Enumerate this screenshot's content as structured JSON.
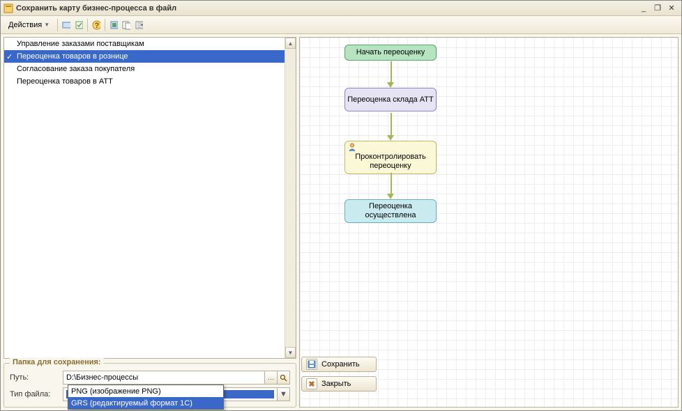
{
  "window": {
    "title": "Сохранить карту бизнес-процесса в файл"
  },
  "toolbar": {
    "actions_label": "Действия"
  },
  "process_list": {
    "items": [
      {
        "label": "Управление заказами поставщикам",
        "selected": false
      },
      {
        "label": "Переоценка товаров в рознице",
        "selected": true
      },
      {
        "label": "Согласование заказа покупателя",
        "selected": false
      },
      {
        "label": "Переоценка товаров в АТТ",
        "selected": false
      }
    ]
  },
  "save_fieldset": {
    "legend": "Папка для сохранения:",
    "path_label": "Путь:",
    "path_value": "D:\\Бизнес-процессы",
    "type_label": "Тип файла:",
    "type_value": "PNG (изображение PNG)",
    "options": [
      "PNG (изображение PNG)",
      "GRS (редактируемый формат 1С)"
    ],
    "highlighted_option_index": 1
  },
  "buttons": {
    "save": "Сохранить",
    "close": "Закрыть"
  },
  "diagram": {
    "node_start": "Начать переоценку",
    "node_proc": "Переоценка склада АТТ",
    "node_task": "Проконтролировать переоценку",
    "node_end": "Переоценка осуществлена"
  }
}
